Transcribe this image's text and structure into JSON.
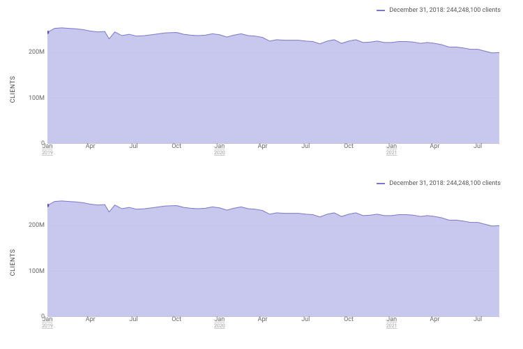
{
  "legend_text": "December 31, 2018: 244,248,100 clients",
  "ylabel": "CLIENTS",
  "y_ticks": [
    {
      "v": 0,
      "label": "0"
    },
    {
      "v": 100000000,
      "label": "100M"
    },
    {
      "v": 200000000,
      "label": "200M"
    }
  ],
  "x_ticks": [
    {
      "t": 0,
      "label": "Jan",
      "year": "2019"
    },
    {
      "t": 3,
      "label": "Apr"
    },
    {
      "t": 6,
      "label": "Jul"
    },
    {
      "t": 9,
      "label": "Oct"
    },
    {
      "t": 12,
      "label": "Jan",
      "year": "2020"
    },
    {
      "t": 15,
      "label": "Apr"
    },
    {
      "t": 18,
      "label": "Jul"
    },
    {
      "t": 21,
      "label": "Oct"
    },
    {
      "t": 24,
      "label": "Jan",
      "year": "2021"
    },
    {
      "t": 27,
      "label": "Apr"
    },
    {
      "t": 30,
      "label": "Jul"
    }
  ],
  "chart_data": [
    {
      "type": "area",
      "ylabel": "CLIENTS",
      "ylim": [
        0,
        260000000
      ],
      "x_unit": "months_since_2019_01",
      "series": [
        {
          "name": "December 31, 2018: 244,248,100 clients",
          "points": [
            {
              "t": 0.0,
              "v": 244248100
            },
            {
              "t": 0.5,
              "v": 253000000
            },
            {
              "t": 1.0,
              "v": 254000000
            },
            {
              "t": 1.5,
              "v": 253000000
            },
            {
              "t": 2.0,
              "v": 252000000
            },
            {
              "t": 2.5,
              "v": 250000000
            },
            {
              "t": 3.0,
              "v": 247000000
            },
            {
              "t": 3.5,
              "v": 245000000
            },
            {
              "t": 4.0,
              "v": 246000000
            },
            {
              "t": 4.3,
              "v": 230000000
            },
            {
              "t": 4.7,
              "v": 245000000
            },
            {
              "t": 5.2,
              "v": 237000000
            },
            {
              "t": 5.7,
              "v": 240000000
            },
            {
              "t": 6.2,
              "v": 236000000
            },
            {
              "t": 6.8,
              "v": 237000000
            },
            {
              "t": 7.5,
              "v": 240000000
            },
            {
              "t": 8.2,
              "v": 243000000
            },
            {
              "t": 9.0,
              "v": 244000000
            },
            {
              "t": 9.5,
              "v": 240000000
            },
            {
              "t": 10.0,
              "v": 238000000
            },
            {
              "t": 10.5,
              "v": 237000000
            },
            {
              "t": 11.0,
              "v": 238000000
            },
            {
              "t": 11.5,
              "v": 241000000
            },
            {
              "t": 12.0,
              "v": 239000000
            },
            {
              "t": 12.5,
              "v": 234000000
            },
            {
              "t": 13.0,
              "v": 238000000
            },
            {
              "t": 13.5,
              "v": 241000000
            },
            {
              "t": 14.0,
              "v": 237000000
            },
            {
              "t": 14.5,
              "v": 236000000
            },
            {
              "t": 15.0,
              "v": 233000000
            },
            {
              "t": 15.5,
              "v": 225000000
            },
            {
              "t": 16.0,
              "v": 228000000
            },
            {
              "t": 16.5,
              "v": 227000000
            },
            {
              "t": 17.0,
              "v": 227000000
            },
            {
              "t": 17.5,
              "v": 227000000
            },
            {
              "t": 18.0,
              "v": 225000000
            },
            {
              "t": 18.5,
              "v": 224000000
            },
            {
              "t": 19.0,
              "v": 219000000
            },
            {
              "t": 19.5,
              "v": 225000000
            },
            {
              "t": 20.0,
              "v": 228000000
            },
            {
              "t": 20.5,
              "v": 220000000
            },
            {
              "t": 21.0,
              "v": 225000000
            },
            {
              "t": 21.5,
              "v": 228000000
            },
            {
              "t": 22.0,
              "v": 222000000
            },
            {
              "t": 22.5,
              "v": 223000000
            },
            {
              "t": 23.0,
              "v": 225000000
            },
            {
              "t": 23.5,
              "v": 222000000
            },
            {
              "t": 24.0,
              "v": 222000000
            },
            {
              "t": 24.5,
              "v": 224000000
            },
            {
              "t": 25.0,
              "v": 224000000
            },
            {
              "t": 25.5,
              "v": 223000000
            },
            {
              "t": 26.0,
              "v": 220000000
            },
            {
              "t": 26.5,
              "v": 222000000
            },
            {
              "t": 27.0,
              "v": 220000000
            },
            {
              "t": 27.5,
              "v": 217000000
            },
            {
              "t": 28.0,
              "v": 212000000
            },
            {
              "t": 28.5,
              "v": 212000000
            },
            {
              "t": 29.0,
              "v": 210000000
            },
            {
              "t": 29.5,
              "v": 207000000
            },
            {
              "t": 30.0,
              "v": 207000000
            },
            {
              "t": 30.5,
              "v": 203000000
            },
            {
              "t": 31.0,
              "v": 199000000
            },
            {
              "t": 31.5,
              "v": 200000000
            }
          ]
        }
      ]
    },
    {
      "type": "area",
      "ylabel": "CLIENTS",
      "ylim": [
        0,
        260000000
      ],
      "x_unit": "months_since_2019_01",
      "series": [
        {
          "name": "December 31, 2018: 244,248,100 clients",
          "points": [
            {
              "t": 0.0,
              "v": 244248100
            },
            {
              "t": 0.5,
              "v": 253000000
            },
            {
              "t": 1.0,
              "v": 254000000
            },
            {
              "t": 1.5,
              "v": 253000000
            },
            {
              "t": 2.0,
              "v": 252000000
            },
            {
              "t": 2.5,
              "v": 250000000
            },
            {
              "t": 3.0,
              "v": 247000000
            },
            {
              "t": 3.5,
              "v": 245000000
            },
            {
              "t": 4.0,
              "v": 246000000
            },
            {
              "t": 4.3,
              "v": 230000000
            },
            {
              "t": 4.7,
              "v": 245000000
            },
            {
              "t": 5.2,
              "v": 237000000
            },
            {
              "t": 5.7,
              "v": 240000000
            },
            {
              "t": 6.2,
              "v": 236000000
            },
            {
              "t": 6.8,
              "v": 237000000
            },
            {
              "t": 7.5,
              "v": 240000000
            },
            {
              "t": 8.2,
              "v": 243000000
            },
            {
              "t": 9.0,
              "v": 244000000
            },
            {
              "t": 9.5,
              "v": 240000000
            },
            {
              "t": 10.0,
              "v": 238000000
            },
            {
              "t": 10.5,
              "v": 237000000
            },
            {
              "t": 11.0,
              "v": 238000000
            },
            {
              "t": 11.5,
              "v": 241000000
            },
            {
              "t": 12.0,
              "v": 239000000
            },
            {
              "t": 12.5,
              "v": 234000000
            },
            {
              "t": 13.0,
              "v": 238000000
            },
            {
              "t": 13.5,
              "v": 241000000
            },
            {
              "t": 14.0,
              "v": 237000000
            },
            {
              "t": 14.5,
              "v": 236000000
            },
            {
              "t": 15.0,
              "v": 233000000
            },
            {
              "t": 15.5,
              "v": 225000000
            },
            {
              "t": 16.0,
              "v": 228000000
            },
            {
              "t": 16.5,
              "v": 227000000
            },
            {
              "t": 17.0,
              "v": 227000000
            },
            {
              "t": 17.5,
              "v": 227000000
            },
            {
              "t": 18.0,
              "v": 225000000
            },
            {
              "t": 18.5,
              "v": 224000000
            },
            {
              "t": 19.0,
              "v": 219000000
            },
            {
              "t": 19.5,
              "v": 225000000
            },
            {
              "t": 20.0,
              "v": 228000000
            },
            {
              "t": 20.5,
              "v": 220000000
            },
            {
              "t": 21.0,
              "v": 225000000
            },
            {
              "t": 21.5,
              "v": 228000000
            },
            {
              "t": 22.0,
              "v": 222000000
            },
            {
              "t": 22.5,
              "v": 223000000
            },
            {
              "t": 23.0,
              "v": 225000000
            },
            {
              "t": 23.5,
              "v": 222000000
            },
            {
              "t": 24.0,
              "v": 222000000
            },
            {
              "t": 24.5,
              "v": 224000000
            },
            {
              "t": 25.0,
              "v": 224000000
            },
            {
              "t": 25.5,
              "v": 223000000
            },
            {
              "t": 26.0,
              "v": 220000000
            },
            {
              "t": 26.5,
              "v": 222000000
            },
            {
              "t": 27.0,
              "v": 220000000
            },
            {
              "t": 27.5,
              "v": 217000000
            },
            {
              "t": 28.0,
              "v": 212000000
            },
            {
              "t": 28.5,
              "v": 212000000
            },
            {
              "t": 29.0,
              "v": 210000000
            },
            {
              "t": 29.5,
              "v": 207000000
            },
            {
              "t": 30.0,
              "v": 207000000
            },
            {
              "t": 30.5,
              "v": 203000000
            },
            {
              "t": 31.0,
              "v": 199000000
            },
            {
              "t": 31.5,
              "v": 200000000
            }
          ]
        }
      ]
    }
  ]
}
